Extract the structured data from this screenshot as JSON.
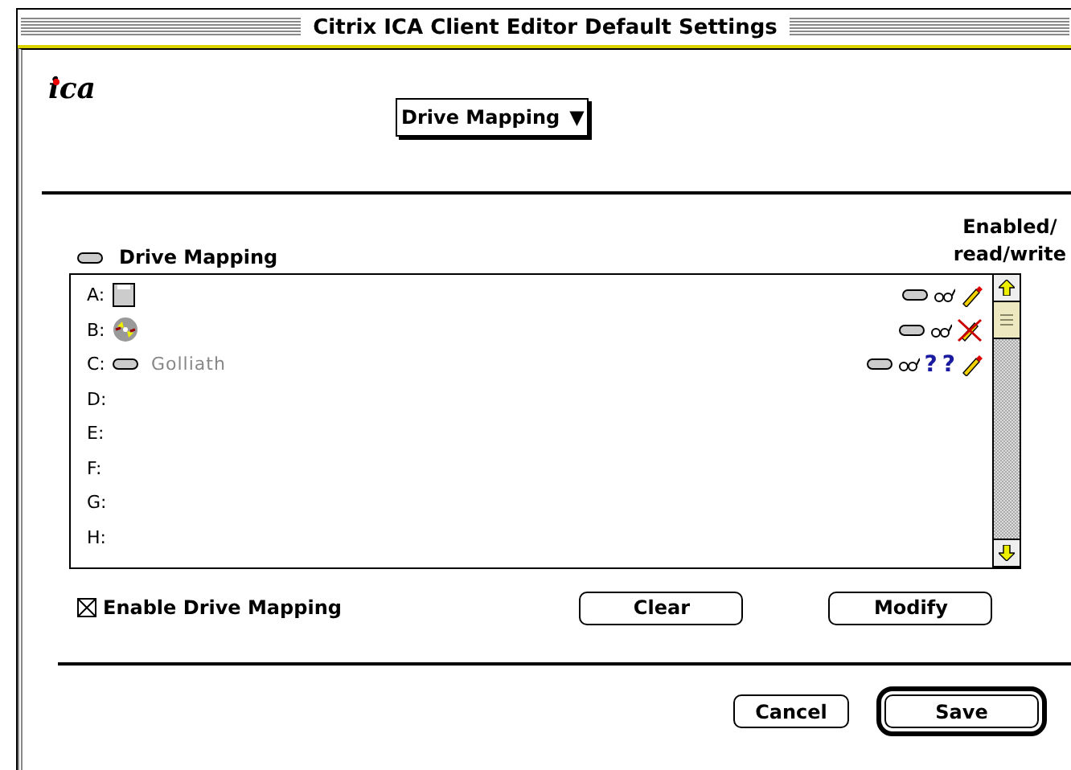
{
  "window": {
    "title": "Citrix ICA Client Editor Default Settings"
  },
  "logo": {
    "text": "ica"
  },
  "section_menu": {
    "label": "Drive Mapping",
    "arrow": "▼"
  },
  "list_header": {
    "title": "Drive Mapping",
    "access_heading": "Enabled/\nread/write"
  },
  "drives": [
    {
      "letter": "A:",
      "kind": "floppy",
      "enabled": true,
      "read": true,
      "write": true,
      "uncertain": false
    },
    {
      "letter": "B:",
      "kind": "cdrom",
      "enabled": true,
      "read": true,
      "write": false,
      "uncertain": false
    },
    {
      "letter": "C:",
      "kind": "disk",
      "name": "Golliath",
      "enabled": true,
      "read": true,
      "write": true,
      "uncertain": true,
      "question": "?"
    },
    {
      "letter": "D:",
      "kind": "none"
    },
    {
      "letter": "E:",
      "kind": "none"
    },
    {
      "letter": "F:",
      "kind": "none"
    },
    {
      "letter": "G:",
      "kind": "none"
    },
    {
      "letter": "H:",
      "kind": "none"
    }
  ],
  "enable_checkbox": {
    "label": "Enable Drive Mapping",
    "checked": true
  },
  "buttons": [
    {
      "label": "Clear",
      "default": false
    },
    {
      "label": "Modify",
      "default": false
    }
  ],
  "dialog_buttons": [
    {
      "label": "Cancel",
      "default": false
    },
    {
      "label": "Save",
      "default": true
    }
  ]
}
